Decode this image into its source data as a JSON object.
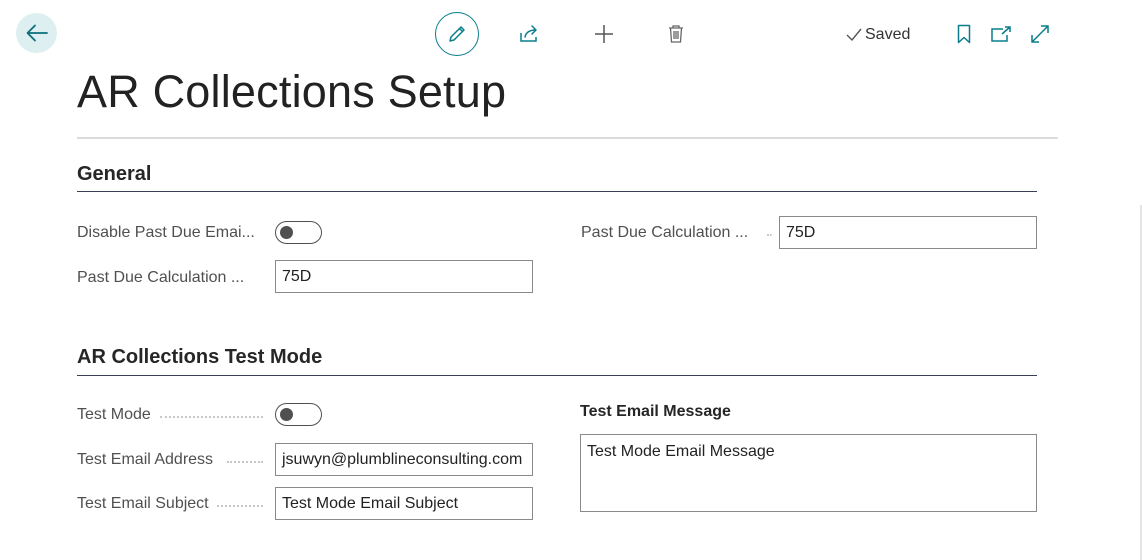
{
  "header": {
    "saved_label": "Saved",
    "icons": [
      "back-arrow-icon",
      "edit-pencil-icon",
      "share-icon",
      "plus-icon",
      "trash-icon",
      "check-icon",
      "bookmark-icon",
      "open-in-new-window-icon",
      "expand-icon"
    ]
  },
  "page": {
    "title": "AR Collections Setup"
  },
  "general": {
    "title": "General",
    "disable_past_due_email": {
      "label": "Disable Past Due Emai...",
      "value": false
    },
    "past_due_calc_left": {
      "label": "Past Due Calculation ...",
      "value": "75D"
    },
    "past_due_calc_right": {
      "label": "Past Due Calculation ...",
      "value": "75D"
    }
  },
  "test_mode": {
    "title": "AR Collections Test Mode",
    "test_mode": {
      "label": "Test Mode",
      "value": false
    },
    "test_email_address": {
      "label": "Test Email Address",
      "value": "jsuwyn@plumblineconsulting.com"
    },
    "test_email_subject": {
      "label": "Test Email Subject",
      "value": "Test Mode Email Subject"
    },
    "test_email_message": {
      "label": "Test Email Message",
      "value": "Test Mode Email Message"
    }
  },
  "colors": {
    "accent": "#0a7d8c",
    "back_bg": "#ddeff1",
    "section_rule": "#3a3f57"
  }
}
